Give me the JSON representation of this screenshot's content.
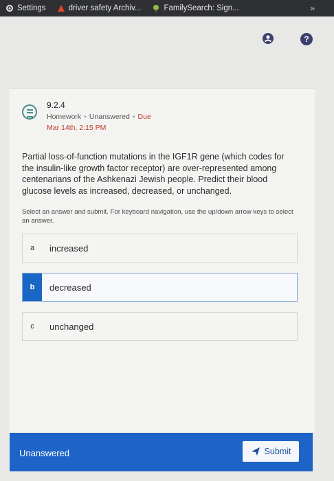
{
  "bookmarks": [
    {
      "label": "Settings",
      "icon": "gear-icon"
    },
    {
      "label": "driver safety Archiv...",
      "icon": "warning-icon"
    },
    {
      "label": "FamilySearch: Sign...",
      "icon": "tree-icon"
    }
  ],
  "bookmarks_more": "»",
  "header": {
    "help_label": "?"
  },
  "question": {
    "number": "9.2.4",
    "type": "Homework",
    "status": "Unanswered",
    "due_label": "Due",
    "due_date": "Mar 14th, 2:15 PM",
    "text": "Partial loss-of-function mutations in the IGF1R gene (which codes for the insulin-like growth factor receptor) are over-represented among centenarians of the Ashkenazi Jewish people.  Predict their blood glucose levels as increased, decreased, or unchanged.",
    "instructions": "Select an answer and submit. For keyboard navigation, use the up/down arrow keys to select an answer."
  },
  "options": [
    {
      "letter": "a",
      "text": "increased",
      "selected": false
    },
    {
      "letter": "b",
      "text": "decreased",
      "selected": true
    },
    {
      "letter": "c",
      "text": "unchanged",
      "selected": false
    }
  ],
  "footer": {
    "status": "Unanswered",
    "submit_label": "Submit"
  },
  "colors": {
    "accent": "#1e64c8",
    "due": "#c0392b",
    "icon_teal": "#4f8c86"
  }
}
